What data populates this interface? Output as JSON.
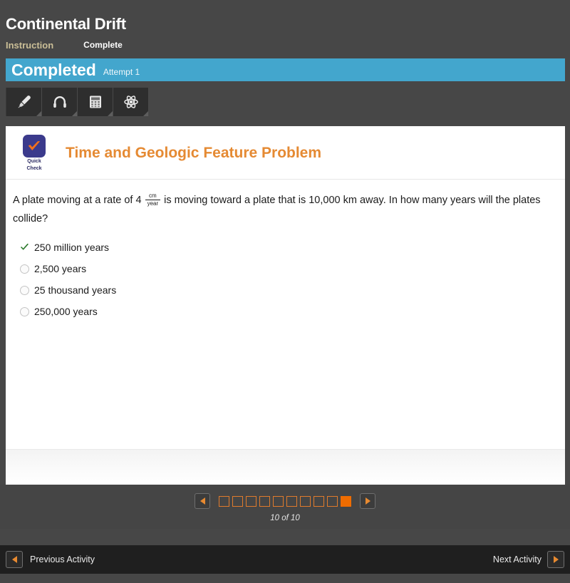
{
  "header": {
    "lesson_title": "Continental Drift",
    "breadcrumb": {
      "instruction": "Instruction",
      "complete": "Complete"
    }
  },
  "status": {
    "label": "Completed",
    "attempt": "Attempt 1",
    "banner_color": "#43a6cd"
  },
  "toolbar": {
    "tools": [
      {
        "name": "highlighter-icon",
        "label": "Highlighter"
      },
      {
        "name": "headphones-icon",
        "label": "Audio"
      },
      {
        "name": "calculator-icon",
        "label": "Calculator"
      },
      {
        "name": "atom-icon",
        "label": "Science Tools"
      }
    ]
  },
  "activity": {
    "badge": {
      "line1": "Quick",
      "line2": "Check"
    },
    "title": "Time and Geologic Feature Problem",
    "title_color": "#e58a33",
    "question": {
      "part1": "A plate moving at a rate of 4",
      "fraction_numerator": "cm",
      "fraction_denominator": "year",
      "part2": "is moving toward a plate that is 10,000 km away. In how many years will the plates collide?"
    },
    "options": [
      {
        "label": "250 million years",
        "state": "selected-correct"
      },
      {
        "label": "2,500 years",
        "state": "unselected"
      },
      {
        "label": "25 thousand years",
        "state": "unselected"
      },
      {
        "label": "250,000 years",
        "state": "unselected"
      }
    ]
  },
  "pager": {
    "total": 10,
    "current": 10,
    "count_text": "10 of 10",
    "prev_label": "Previous page",
    "next_label": "Next page",
    "accent_color": "#ef6c00"
  },
  "footer": {
    "previous_activity": "Previous Activity",
    "next_activity": "Next Activity"
  }
}
